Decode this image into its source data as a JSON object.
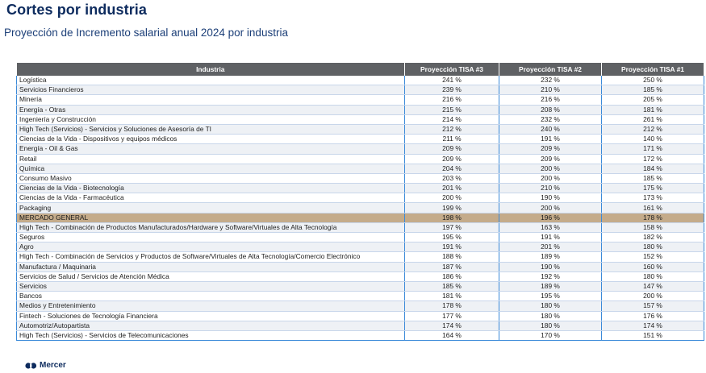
{
  "header": {
    "title": "Cortes por industria",
    "subtitle": "Proyección de Incremento salarial anual 2024 por industria"
  },
  "table": {
    "columns": [
      "Industria",
      "Proyección TISA #3",
      "Proyección TISA #2",
      "Proyección TISA #1"
    ],
    "highlight_label": "MERCADO GENERAL",
    "highlight_color": "#c4ab8a",
    "rows": [
      [
        "Logística",
        "241 %",
        "232 %",
        "250 %"
      ],
      [
        "Servicios Financieros",
        "239 %",
        "210 %",
        "185 %"
      ],
      [
        "Minería",
        "216 %",
        "216 %",
        "205 %"
      ],
      [
        "Energía - Otras",
        "215 %",
        "208 %",
        "181 %"
      ],
      [
        "Ingeniería y Construcción",
        "214 %",
        "232 %",
        "261 %"
      ],
      [
        "High Tech (Servicios) - Servicios y Soluciones de Asesoría de TI",
        "212 %",
        "240 %",
        "212 %"
      ],
      [
        "Ciencias de la Vida - Dispositivos y equipos médicos",
        "211 %",
        "191 %",
        "140 %"
      ],
      [
        "Energía - Oil & Gas",
        "209 %",
        "209 %",
        "171 %"
      ],
      [
        "Retail",
        "209 %",
        "209 %",
        "172 %"
      ],
      [
        "Química",
        "204 %",
        "200 %",
        "184 %"
      ],
      [
        "Consumo Masivo",
        "203 %",
        "200 %",
        "185 %"
      ],
      [
        "Ciencias de la Vida - Biotecnología",
        "201 %",
        "210 %",
        "175 %"
      ],
      [
        "Ciencias de la Vida - Farmacéutica",
        "200 %",
        "190 %",
        "173 %"
      ],
      [
        "Packaging",
        "199 %",
        "200 %",
        "161 %"
      ],
      [
        "MERCADO GENERAL",
        "198 %",
        "196 %",
        "178 %"
      ],
      [
        "High Tech - Combinación de Productos Manufacturados/Hardware y Software/Virtuales de Alta Tecnología",
        "197 %",
        "163 %",
        "158 %"
      ],
      [
        "Seguros",
        "195 %",
        "191 %",
        "182 %"
      ],
      [
        "Agro",
        "191 %",
        "201 %",
        "180 %"
      ],
      [
        "High Tech - Combinación de Servicios y Productos de Software/Virtuales de Alta Tecnología/Comercio Electrónico",
        "188 %",
        "189 %",
        "152 %"
      ],
      [
        "Manufactura / Maquinaria",
        "187 %",
        "190 %",
        "160 %"
      ],
      [
        "Servicios de Salud / Servicios de Atención Médica",
        "186 %",
        "192 %",
        "180 %"
      ],
      [
        "Servicios",
        "185 %",
        "189 %",
        "147 %"
      ],
      [
        "Bancos",
        "181 %",
        "195 %",
        "200 %"
      ],
      [
        "Medios y Entretenimiento",
        "178 %",
        "180 %",
        "157 %"
      ],
      [
        "Fintech - Soluciones de Tecnología Financiera",
        "177 %",
        "180 %",
        "176 %"
      ],
      [
        "Automotriz/Autopartista",
        "174 %",
        "180 %",
        "174 %"
      ],
      [
        "High Tech (Servicios) - Servicios de Telecomunicaciones",
        "164 %",
        "170 %",
        "151 %"
      ]
    ]
  },
  "footer": {
    "brand": "Mercer",
    "logo_icon": "mercer-logo-icon"
  }
}
